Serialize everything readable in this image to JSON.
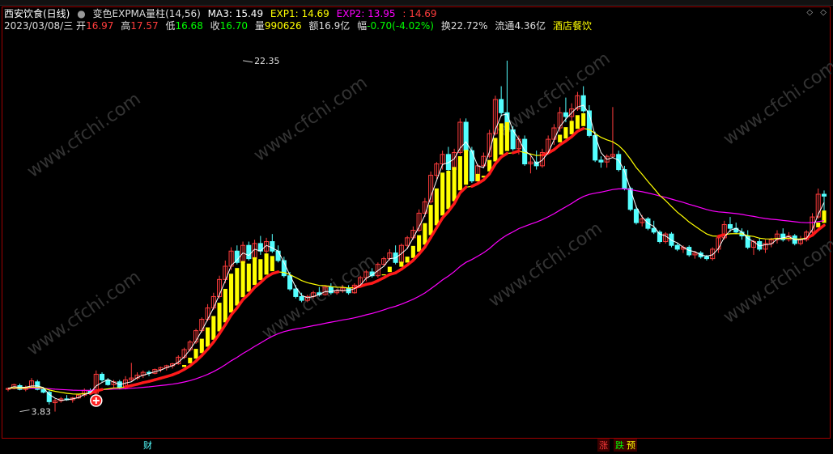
{
  "header": {
    "stock_name": "西安饮食(日线)",
    "indicator_name": "变色EXPMA量柱(14,56)",
    "ma3_label": "MA3: 15.49",
    "exp1_label": "EXP1: 14.69",
    "exp2_label": "EXP2: 13.95",
    "extra_value": ": 14.69",
    "date": "2023/03/08/三",
    "open_label": "开",
    "open_value": "16.97",
    "high_label": "高",
    "high_value": "17.57",
    "low_label": "低",
    "low_value": "16.68",
    "close_label": "收",
    "close_value": "16.70",
    "volume_label": "量",
    "volume_value": "990626",
    "amount_label": "额",
    "amount_value": "16.9亿",
    "change_label": "幅",
    "change_value": "-0.70(-4.02%)",
    "turnover_label": "换",
    "turnover_value": "22.72%",
    "float_label": "流通",
    "float_value": "4.36亿",
    "sector": "酒店餐饮"
  },
  "controls": {
    "left_glyph": "◇",
    "right_glyph": "◇"
  },
  "markers": {
    "cai": "财",
    "zhang": "涨",
    "die": "跌",
    "yu": "预"
  },
  "colors": {
    "up": "#ff3c3c",
    "down": "#54ffff",
    "ma3": "#ffffff",
    "exp1": "#ffff00",
    "exp2": "#ff00ff",
    "cross_bg": "#ff2020",
    "yellow_bar": "#ffff00",
    "watermark": "#333333"
  },
  "watermark_text": "www.cfchi.com",
  "chart_data": {
    "type": "candlestick",
    "ylim": [
      3.0,
      23.5
    ],
    "annotations": [
      {
        "text": "22.35",
        "x": 40,
        "y": 22.35,
        "kind": "high"
      },
      {
        "text": "3.83",
        "x": 2,
        "y": 3.83,
        "kind": "low"
      }
    ],
    "candles": [
      [
        5.0,
        5.1,
        4.9,
        5.05
      ],
      [
        5.05,
        5.3,
        5.0,
        5.25
      ],
      [
        5.2,
        5.3,
        4.95,
        5.0
      ],
      [
        5.0,
        5.2,
        4.9,
        5.1
      ],
      [
        5.1,
        5.6,
        5.05,
        5.45
      ],
      [
        5.4,
        5.5,
        4.95,
        5.0
      ],
      [
        5.0,
        5.1,
        4.8,
        4.85
      ],
      [
        4.85,
        4.95,
        4.2,
        4.35
      ],
      [
        4.3,
        4.5,
        3.83,
        4.4
      ],
      [
        4.4,
        4.6,
        4.3,
        4.5
      ],
      [
        4.5,
        4.7,
        4.4,
        4.45
      ],
      [
        4.45,
        4.6,
        4.3,
        4.55
      ],
      [
        4.55,
        4.75,
        4.5,
        4.7
      ],
      [
        4.7,
        5.05,
        4.6,
        4.95
      ],
      [
        4.9,
        5.05,
        4.7,
        4.8
      ],
      [
        4.8,
        6.0,
        4.75,
        5.8
      ],
      [
        5.8,
        5.9,
        5.4,
        5.5
      ],
      [
        5.5,
        5.6,
        5.2,
        5.25
      ],
      [
        5.25,
        5.5,
        5.1,
        5.4
      ],
      [
        5.4,
        5.5,
        5.0,
        5.1
      ],
      [
        5.1,
        5.7,
        5.0,
        5.5
      ],
      [
        5.5,
        6.4,
        5.45,
        5.6
      ],
      [
        5.6,
        5.9,
        5.5,
        5.75
      ],
      [
        5.75,
        6.0,
        5.6,
        5.9
      ],
      [
        5.9,
        6.0,
        5.7,
        5.85
      ],
      [
        5.85,
        6.1,
        5.8,
        6.05
      ],
      [
        6.05,
        6.2,
        5.9,
        6.15
      ],
      [
        6.15,
        6.3,
        6.0,
        6.25
      ],
      [
        6.25,
        6.4,
        6.1,
        6.35
      ],
      [
        6.35,
        6.8,
        6.3,
        6.7
      ],
      [
        6.7,
        7.2,
        6.6,
        7.1
      ],
      [
        7.1,
        7.6,
        7.0,
        7.5
      ],
      [
        7.5,
        8.2,
        7.4,
        8.1
      ],
      [
        8.1,
        8.8,
        8.0,
        8.7
      ],
      [
        8.7,
        9.5,
        8.6,
        9.3
      ],
      [
        9.3,
        10.1,
        9.2,
        9.9
      ],
      [
        9.9,
        11.0,
        9.8,
        10.8
      ],
      [
        10.8,
        11.8,
        10.6,
        11.5
      ],
      [
        11.5,
        12.5,
        11.3,
        12.3
      ],
      [
        12.3,
        12.6,
        11.6,
        11.7
      ],
      [
        11.7,
        12.8,
        11.6,
        12.6
      ],
      [
        12.6,
        12.8,
        11.8,
        11.9
      ],
      [
        11.9,
        12.9,
        11.8,
        12.7
      ],
      [
        12.7,
        13.1,
        12.1,
        12.3
      ],
      [
        12.3,
        13.0,
        12.0,
        12.8
      ],
      [
        12.8,
        13.2,
        12.2,
        12.3
      ],
      [
        12.3,
        12.6,
        11.7,
        11.8
      ],
      [
        11.8,
        12.0,
        10.9,
        11.0
      ],
      [
        11.0,
        11.2,
        10.2,
        10.3
      ],
      [
        10.3,
        10.5,
        9.8,
        9.9
      ],
      [
        9.9,
        10.1,
        9.6,
        9.7
      ],
      [
        9.7,
        10.0,
        9.6,
        9.9
      ],
      [
        9.9,
        10.2,
        9.8,
        10.1
      ],
      [
        10.1,
        10.4,
        9.9,
        10.0
      ],
      [
        10.0,
        10.5,
        9.95,
        10.4
      ],
      [
        10.4,
        10.6,
        10.0,
        10.1
      ],
      [
        10.1,
        10.3,
        10.0,
        10.2
      ],
      [
        10.2,
        10.5,
        10.1,
        10.35
      ],
      [
        10.35,
        10.5,
        10.0,
        10.1
      ],
      [
        10.1,
        10.6,
        10.05,
        10.5
      ],
      [
        10.5,
        11.0,
        10.4,
        10.9
      ],
      [
        10.9,
        11.3,
        10.7,
        11.2
      ],
      [
        11.2,
        11.4,
        10.9,
        11.0
      ],
      [
        11.0,
        11.7,
        10.9,
        11.6
      ],
      [
        11.6,
        12.0,
        11.5,
        11.9
      ],
      [
        11.9,
        12.4,
        11.8,
        12.2
      ],
      [
        12.2,
        12.6,
        11.6,
        11.7
      ],
      [
        11.7,
        12.7,
        11.6,
        12.6
      ],
      [
        12.6,
        13.1,
        12.4,
        13.0
      ],
      [
        13.0,
        13.6,
        12.9,
        13.4
      ],
      [
        13.4,
        14.5,
        13.3,
        14.3
      ],
      [
        14.3,
        15.1,
        14.1,
        14.9
      ],
      [
        14.9,
        16.5,
        14.8,
        16.3
      ],
      [
        16.3,
        17.0,
        16.1,
        16.9
      ],
      [
        16.9,
        17.6,
        16.6,
        17.4
      ],
      [
        17.4,
        17.8,
        16.4,
        16.6
      ],
      [
        16.6,
        17.7,
        16.5,
        17.5
      ],
      [
        17.5,
        19.3,
        17.4,
        19.1
      ],
      [
        19.1,
        19.3,
        17.4,
        17.6
      ],
      [
        17.6,
        17.8,
        15.9,
        16.0
      ],
      [
        16.0,
        16.9,
        15.9,
        16.8
      ],
      [
        16.8,
        17.5,
        16.7,
        17.3
      ],
      [
        17.3,
        18.7,
        17.2,
        18.5
      ],
      [
        18.5,
        20.5,
        18.4,
        20.3
      ],
      [
        20.3,
        21.0,
        19.4,
        19.6
      ],
      [
        19.6,
        22.35,
        18.6,
        18.7
      ],
      [
        18.7,
        18.9,
        17.6,
        17.7
      ],
      [
        17.7,
        18.4,
        17.4,
        18.2
      ],
      [
        18.2,
        18.4,
        16.8,
        16.9
      ],
      [
        16.9,
        17.3,
        16.4,
        17.0
      ],
      [
        17.0,
        17.6,
        16.6,
        16.8
      ],
      [
        16.8,
        17.7,
        16.7,
        17.5
      ],
      [
        17.5,
        18.4,
        17.4,
        18.2
      ],
      [
        18.2,
        19.0,
        17.9,
        18.8
      ],
      [
        18.8,
        19.9,
        18.6,
        19.6
      ],
      [
        19.6,
        20.4,
        19.1,
        19.4
      ],
      [
        19.4,
        20.1,
        19.0,
        19.8
      ],
      [
        19.8,
        20.7,
        19.7,
        20.5
      ],
      [
        20.5,
        21.0,
        19.6,
        19.7
      ],
      [
        19.7,
        20.0,
        18.3,
        18.4
      ],
      [
        18.4,
        18.6,
        17.0,
        17.1
      ],
      [
        17.1,
        17.3,
        16.7,
        17.0
      ],
      [
        17.0,
        17.4,
        16.7,
        17.3
      ],
      [
        17.3,
        19.9,
        17.2,
        17.4
      ],
      [
        17.4,
        17.6,
        16.5,
        16.6
      ],
      [
        16.6,
        16.8,
        15.5,
        15.6
      ],
      [
        15.6,
        15.7,
        14.4,
        14.5
      ],
      [
        14.5,
        14.7,
        13.7,
        13.8
      ],
      [
        13.8,
        14.2,
        13.6,
        14.0
      ],
      [
        14.0,
        14.1,
        13.4,
        13.5
      ],
      [
        13.5,
        13.9,
        13.2,
        13.3
      ],
      [
        13.3,
        13.4,
        12.7,
        12.8
      ],
      [
        12.8,
        13.3,
        12.7,
        13.2
      ],
      [
        13.2,
        13.3,
        12.5,
        12.6
      ],
      [
        12.6,
        12.7,
        12.3,
        12.4
      ],
      [
        12.4,
        12.6,
        12.2,
        12.5
      ],
      [
        12.5,
        12.6,
        12.0,
        12.1
      ],
      [
        12.1,
        12.3,
        11.9,
        12.2
      ],
      [
        12.2,
        12.3,
        11.9,
        12.0
      ],
      [
        12.0,
        12.1,
        11.8,
        11.9
      ],
      [
        11.9,
        12.5,
        11.8,
        12.4
      ],
      [
        12.4,
        13.1,
        12.2,
        13.0
      ],
      [
        13.0,
        13.9,
        12.9,
        13.7
      ],
      [
        13.7,
        14.1,
        13.3,
        13.5
      ],
      [
        13.5,
        13.8,
        13.2,
        13.3
      ],
      [
        13.3,
        13.5,
        12.9,
        13.1
      ],
      [
        13.1,
        13.4,
        12.4,
        12.5
      ],
      [
        12.5,
        12.9,
        12.1,
        12.8
      ],
      [
        12.8,
        13.0,
        12.3,
        12.4
      ],
      [
        12.4,
        12.9,
        12.2,
        12.7
      ],
      [
        12.7,
        13.0,
        12.5,
        12.9
      ],
      [
        12.9,
        13.4,
        12.7,
        13.2
      ],
      [
        13.2,
        13.5,
        12.8,
        12.9
      ],
      [
        12.9,
        13.3,
        12.8,
        13.1
      ],
      [
        13.1,
        13.2,
        12.6,
        12.7
      ],
      [
        12.7,
        13.1,
        12.6,
        12.9
      ],
      [
        12.9,
        13.4,
        12.8,
        13.3
      ],
      [
        13.3,
        14.3,
        13.2,
        14.1
      ],
      [
        14.1,
        15.6,
        14.0,
        15.3
      ],
      [
        15.3,
        15.5,
        14.2,
        15.2
      ]
    ]
  }
}
